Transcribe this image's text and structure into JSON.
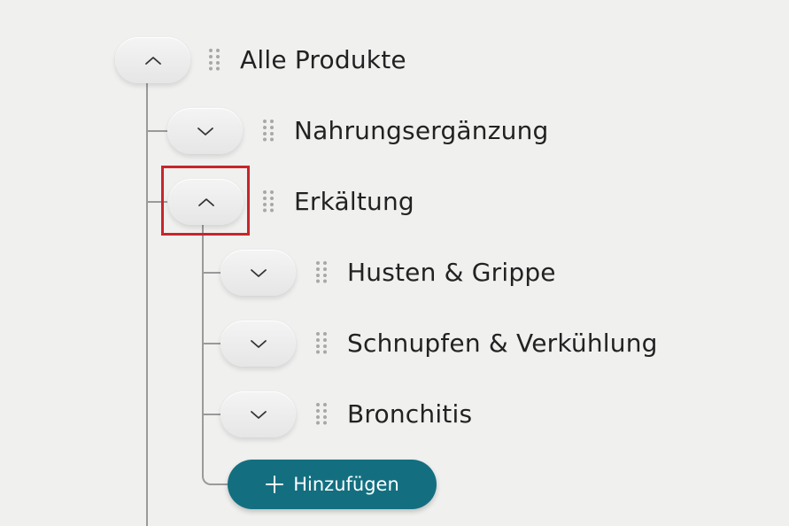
{
  "tree": {
    "root": {
      "label": "Alle Produkte",
      "state": "expanded",
      "toggle_icon": "chevron-up-icon"
    },
    "children": [
      {
        "label": "Nahrungsergänzung",
        "state": "collapsed",
        "toggle_icon": "chevron-down-icon"
      },
      {
        "label": "Erkältung",
        "state": "expanded",
        "toggle_icon": "chevron-up-icon",
        "highlighted": true,
        "children": [
          {
            "label": "Husten & Grippe",
            "state": "collapsed",
            "toggle_icon": "chevron-down-icon"
          },
          {
            "label": "Schnupfen & Verkühlung",
            "state": "collapsed",
            "toggle_icon": "chevron-down-icon"
          },
          {
            "label": "Bronchitis",
            "state": "collapsed",
            "toggle_icon": "chevron-down-icon"
          }
        ]
      }
    ],
    "add_button": {
      "label": "Hinzufügen",
      "icon": "plus-icon"
    }
  },
  "colors": {
    "background": "#f0f0ef",
    "tree_line": "#9a9a9a",
    "highlight_border": "#c8252b",
    "add_button": "#136f80",
    "text": "#222222"
  }
}
